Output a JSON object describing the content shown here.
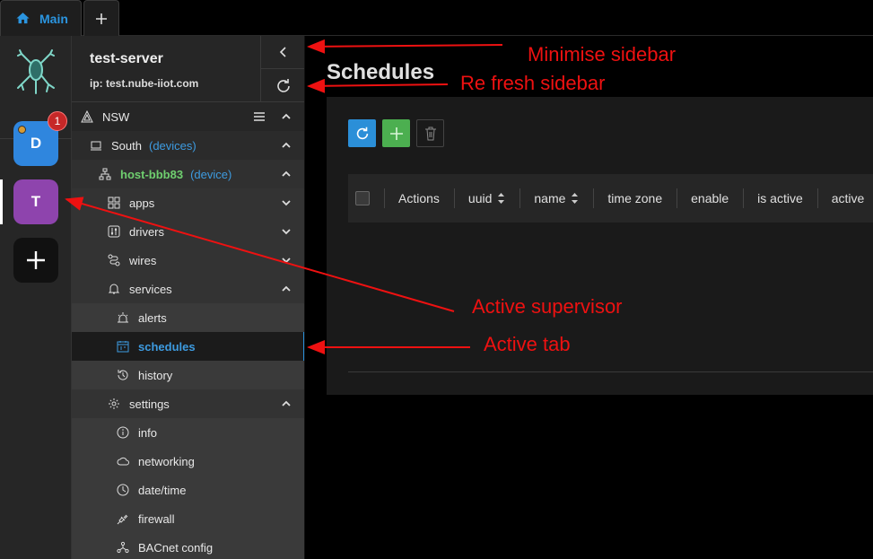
{
  "tabs": {
    "main_label": "Main",
    "add_label": "+"
  },
  "supervisors": [
    {
      "initial": "D",
      "badge": "1"
    },
    {
      "initial": "T"
    }
  ],
  "server": {
    "name": "test-server",
    "ip": "ip: test.nube-iiot.com"
  },
  "tree": {
    "network": "NSW",
    "group": {
      "name": "South",
      "type": "(devices)"
    },
    "device": {
      "name": "host-bbb83",
      "type": "(device)"
    },
    "items": [
      {
        "label": "apps",
        "icon": "apps-icon",
        "state": "collapsed"
      },
      {
        "label": "drivers",
        "icon": "sliders-icon",
        "state": "collapsed"
      },
      {
        "label": "wires",
        "icon": "wires-icon",
        "state": "collapsed"
      },
      {
        "label": "services",
        "icon": "bell-icon",
        "state": "expanded"
      },
      {
        "label": "alerts",
        "icon": "siren-icon"
      },
      {
        "label": "schedules",
        "icon": "calendar-icon",
        "active": true
      },
      {
        "label": "history",
        "icon": "history-icon"
      },
      {
        "label": "settings",
        "icon": "gear-icon",
        "state": "expanded"
      },
      {
        "label": "info",
        "icon": "info-icon"
      },
      {
        "label": "networking",
        "icon": "cloud-icon"
      },
      {
        "label": "date/time",
        "icon": "clock-icon"
      },
      {
        "label": "firewall",
        "icon": "plug-icon"
      },
      {
        "label": "BACnet config",
        "icon": "network-icon"
      }
    ]
  },
  "page": {
    "title": "Schedules"
  },
  "table": {
    "columns": [
      "Actions",
      "uuid",
      "name",
      "time zone",
      "enable",
      "is active",
      "active"
    ]
  },
  "annotations": {
    "minimise": "Minimise sidebar",
    "refresh": "Re fresh sidebar",
    "supervisor": "Active supervisor",
    "tab": "Active tab"
  },
  "colors": {
    "accent": "#2b8fd8",
    "annotation": "#ee1111",
    "device": "#6fcf6f",
    "supervisor_t": "#8e44ad",
    "supervisor_d": "#2f86de"
  }
}
